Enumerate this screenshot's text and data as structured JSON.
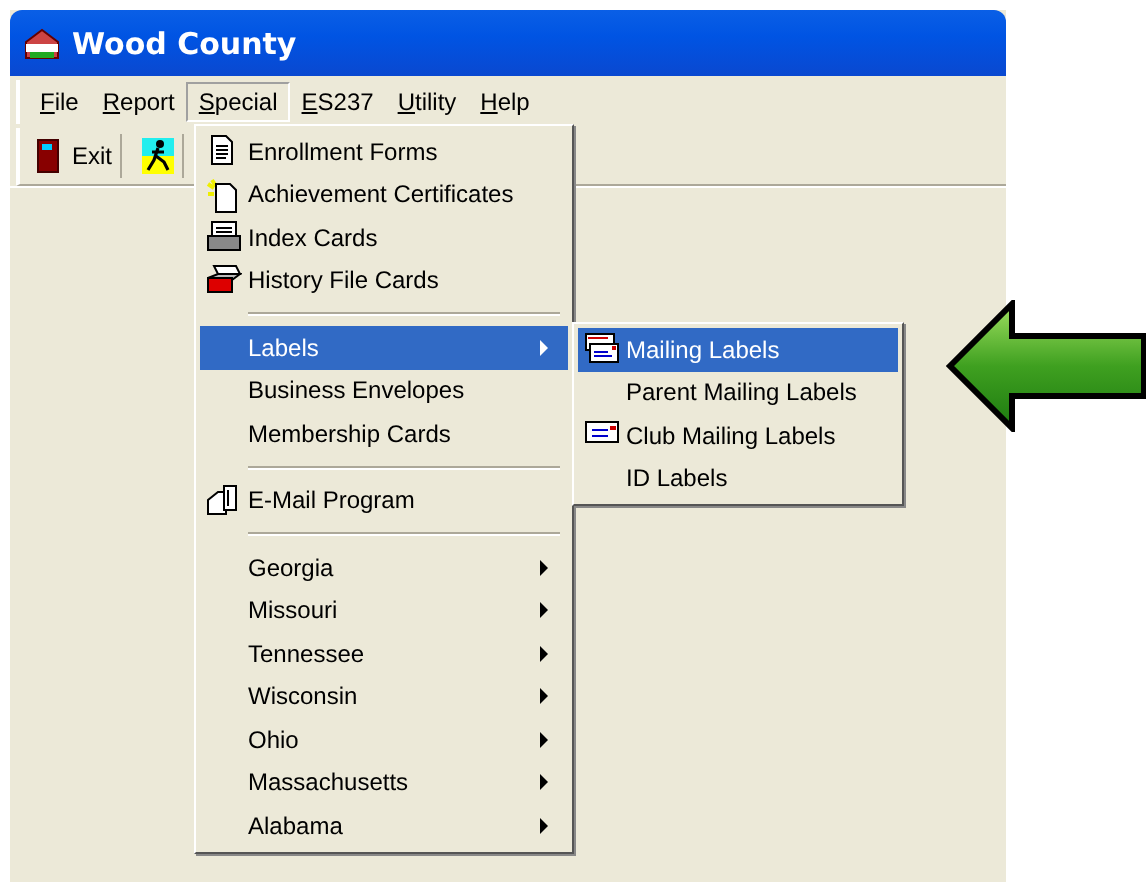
{
  "window": {
    "title": "Wood County"
  },
  "menubar": [
    {
      "label": "File",
      "selected": false
    },
    {
      "label": "Report",
      "selected": false
    },
    {
      "label": "Special",
      "selected": true
    },
    {
      "label": "ES237",
      "selected": false
    },
    {
      "label": "Utility",
      "selected": false
    },
    {
      "label": "Help",
      "selected": false
    }
  ],
  "toolbar": [
    {
      "kind": "exit",
      "label": "Exit"
    },
    {
      "kind": "runner"
    }
  ],
  "special_menu": [
    {
      "kind": "item",
      "label": "Enrollment Forms",
      "selected": false
    },
    {
      "kind": "item",
      "label": "Achievement Certificates",
      "selected": false
    },
    {
      "kind": "item",
      "label": "Index Cards",
      "selected": false
    },
    {
      "kind": "item",
      "label": "History File Cards",
      "selected": false
    },
    {
      "kind": "separator"
    },
    {
      "kind": "submenu",
      "label": "Labels",
      "selected": true,
      "submenu": [
        {
          "label": "Mailing Labels",
          "selected": true
        },
        {
          "label": "Parent Mailing Labels",
          "selected": false
        },
        {
          "label": "Club Mailing Labels",
          "selected": false
        },
        {
          "label": "ID Labels",
          "selected": false
        }
      ]
    },
    {
      "kind": "item",
      "label": "Business Envelopes",
      "selected": false
    },
    {
      "kind": "item",
      "label": "Membership Cards",
      "selected": false
    },
    {
      "kind": "separator"
    },
    {
      "kind": "item",
      "label": "E-Mail Program",
      "selected": false
    },
    {
      "kind": "separator"
    },
    {
      "kind": "submenu",
      "label": "Georgia",
      "selected": false
    },
    {
      "kind": "submenu",
      "label": "Missouri",
      "selected": false
    },
    {
      "kind": "submenu",
      "label": "Tennessee",
      "selected": false
    },
    {
      "kind": "submenu",
      "label": "Wisconsin",
      "selected": false
    },
    {
      "kind": "submenu",
      "label": "Ohio",
      "selected": false
    },
    {
      "kind": "submenu",
      "label": "Massachusetts",
      "selected": false
    },
    {
      "kind": "submenu",
      "label": "Alabama",
      "selected": false
    }
  ]
}
